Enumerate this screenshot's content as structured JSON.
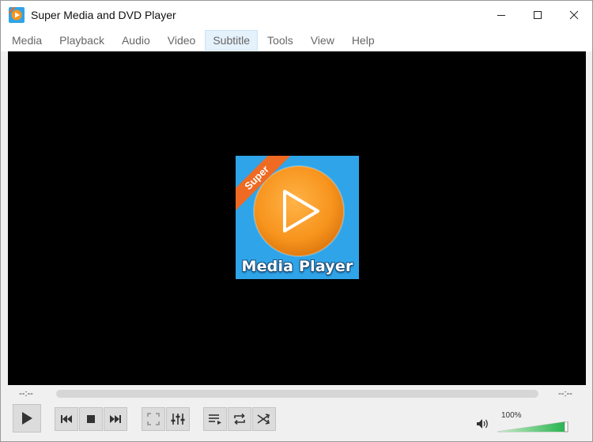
{
  "window": {
    "title": "Super Media and DVD Player",
    "icon": "app-icon"
  },
  "menu": {
    "items": [
      "Media",
      "Playback",
      "Audio",
      "Video",
      "Subtitle",
      "Tools",
      "View",
      "Help"
    ],
    "highlighted": "Subtitle"
  },
  "video": {
    "logo_ribbon": "Super",
    "logo_text": "Media Player",
    "logo_colors": {
      "background": "#2fa4e8",
      "circle": "#f7941d",
      "ribbon": "#ef6a22"
    }
  },
  "seek": {
    "elapsed": "--:--",
    "remaining": "--:--",
    "position": 0
  },
  "controls": {
    "buttons": [
      "play-icon",
      "previous-icon",
      "stop-icon",
      "next-icon",
      "fullscreen-icon",
      "equalizer-icon",
      "playlist-icon",
      "loop-icon",
      "shuffle-icon"
    ]
  },
  "volume": {
    "label": "100%",
    "level": 1.0,
    "fill_color": "#22b14c"
  }
}
